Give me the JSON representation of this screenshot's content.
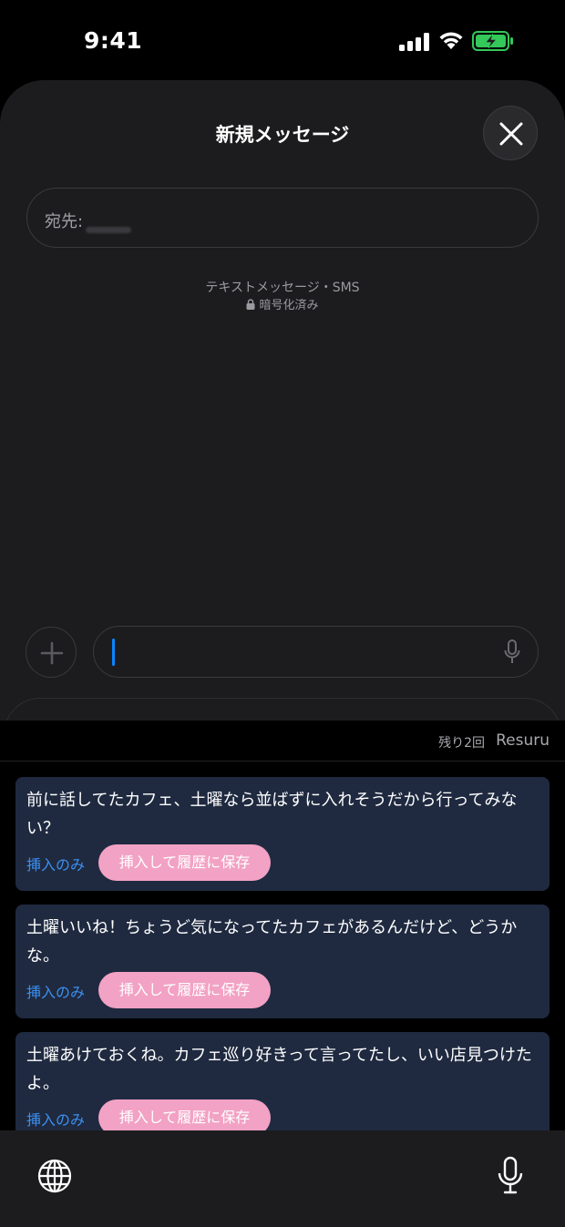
{
  "status_bar": {
    "time": "9:41"
  },
  "sheet": {
    "title": "新規メッセージ",
    "to_label": "宛先:",
    "sms_label": "テキストメッセージ・SMS",
    "encryption_label": "暗号化済み"
  },
  "keyboard": {
    "remaining": "残り2回",
    "brand": "Resuru",
    "suggestions": [
      {
        "text": "前に話してたカフェ、土曜なら並ばずに入れそうだから行ってみない？",
        "insert_only": "挿入のみ",
        "insert_save": "挿入して履歴に保存"
      },
      {
        "text": "土曜いいね！ちょうど気になってたカフェがあるんだけど、どうかな。",
        "insert_only": "挿入のみ",
        "insert_save": "挿入して履歴に保存"
      },
      {
        "text": "土曜あけておくね。カフェ巡り好きって言ってたし、いい店見つけたよ。",
        "insert_only": "挿入のみ",
        "insert_save": "挿入して履歴に保存"
      }
    ]
  },
  "colors": {
    "accent_blue": "#0a84ff",
    "link_blue": "#3b8ff0",
    "pink_button": "#f2a2c4",
    "card_bg": "#1f2a40",
    "battery_green": "#34c759"
  },
  "icons": [
    "signal-icon",
    "wifi-icon",
    "battery-charging-icon",
    "close-icon",
    "lock-icon",
    "plus-icon",
    "microphone-icon",
    "globe-icon",
    "dictation-icon"
  ]
}
